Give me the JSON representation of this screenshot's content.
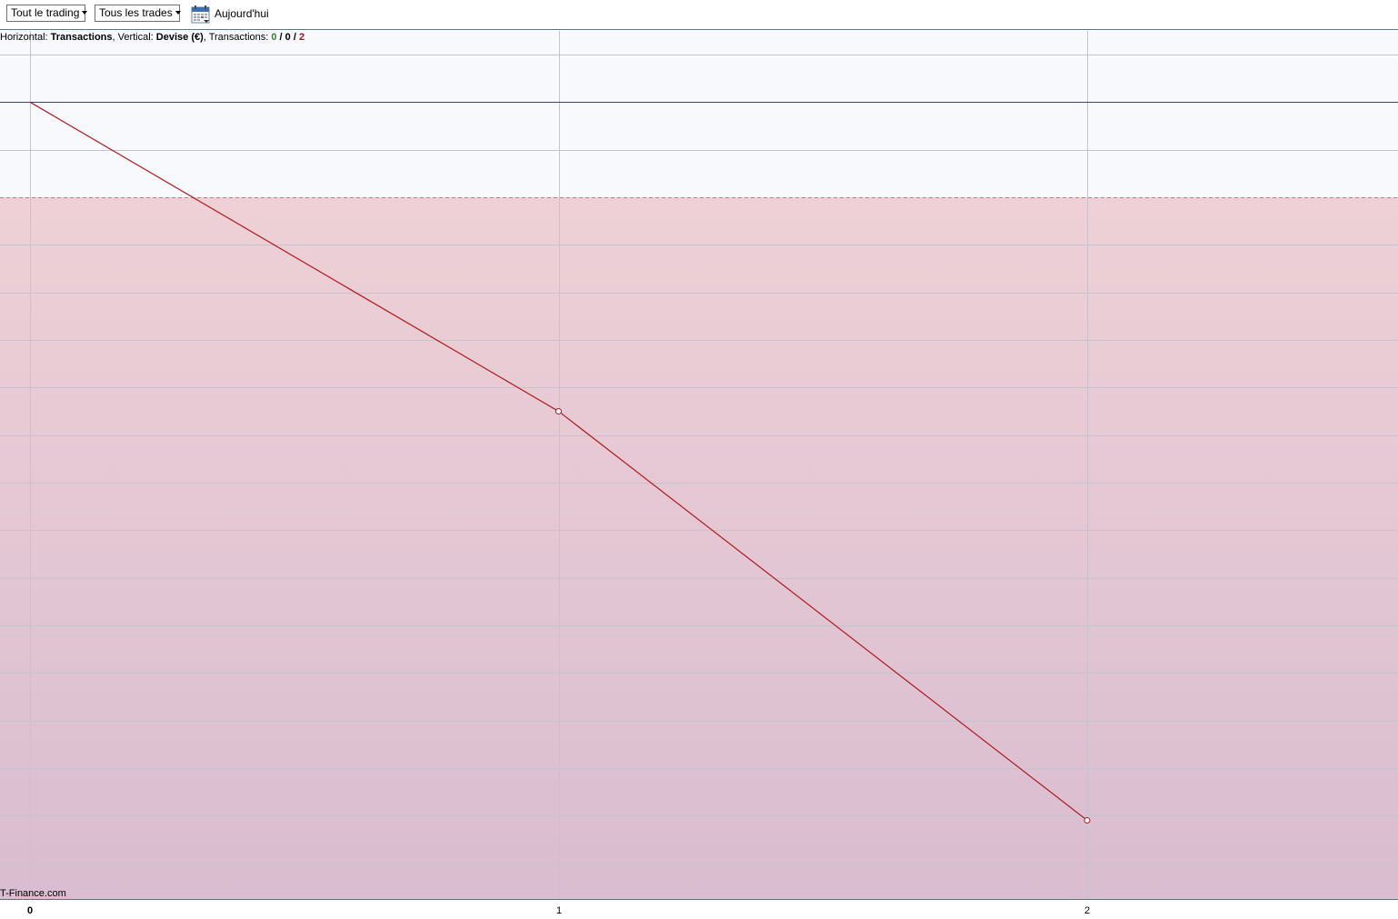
{
  "toolbar": {
    "trading_dropdown": "Tout le trading",
    "trades_dropdown": "Tous les trades",
    "today_label": "Aujourd'hui",
    "calendar_icon": "calendar-icon"
  },
  "info": {
    "horizontal_prefix": "Horizontal: ",
    "horizontal_value": "Transactions",
    "vertical_prefix": ", Vertical: ",
    "vertical_value": "Devise (€)",
    "transactions_prefix": ", Transactions: ",
    "wins": "0",
    "sep1": " / ",
    "even": "0",
    "sep2": " / ",
    "losses": "2"
  },
  "watermark": "T-Finance.com",
  "colors": {
    "line": "#b0181c",
    "loss_fill_top": "#eed0d6",
    "loss_fill_bottom": "#d9bdd0",
    "upper_band": "#f8f9fd",
    "grid": "#c4c4cc",
    "zero_line": "#3c4468",
    "dashed_ref": "#c08080"
  },
  "chart_data": {
    "type": "line",
    "xlabel": "Transactions",
    "ylabel": "Devise (€)",
    "x_tick_labels": [
      "0",
      "1",
      "2"
    ],
    "x": [
      0,
      1,
      2
    ],
    "y": [
      0,
      -6.5,
      -15.1
    ],
    "y_reference": -2,
    "xlim": [
      0,
      2.56
    ],
    "ylim": [
      -16.2,
      1
    ],
    "grid": true,
    "y_tick_labels": []
  }
}
